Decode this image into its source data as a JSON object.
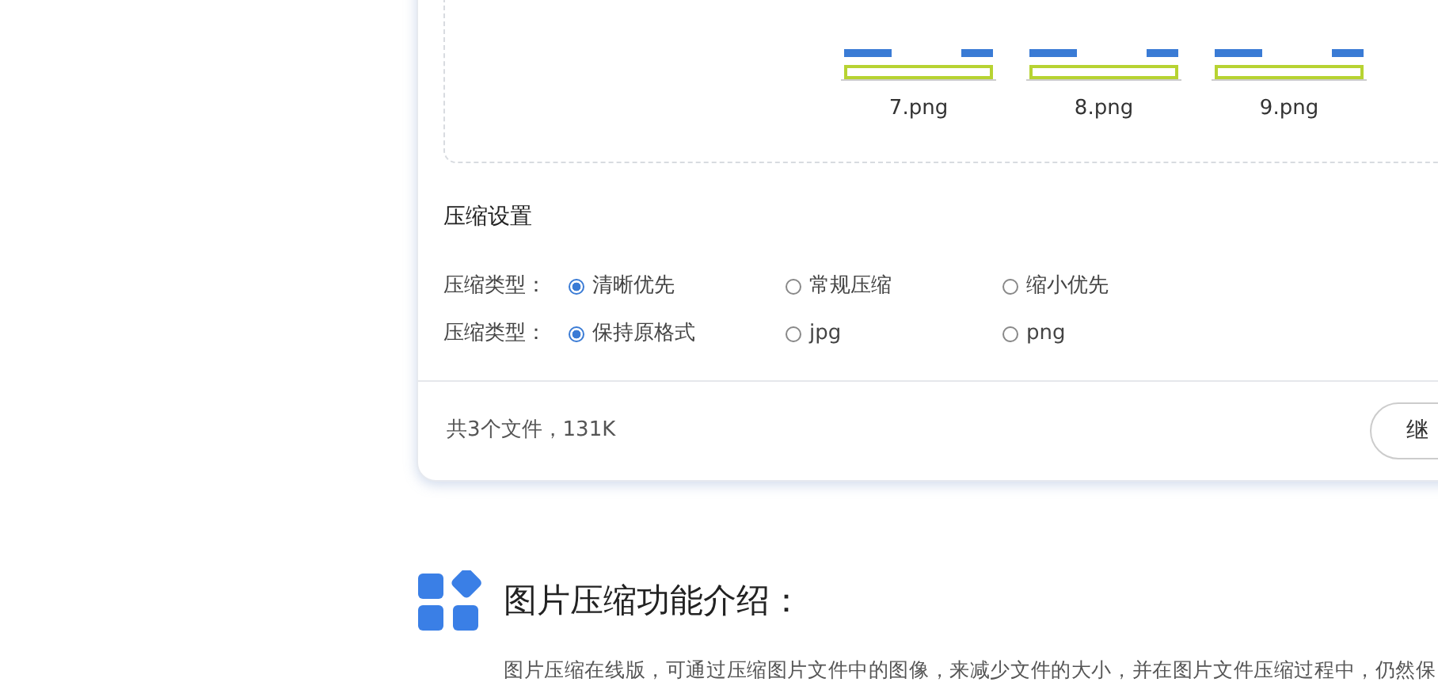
{
  "upload_area": {
    "thumbnails": [
      {
        "filename": "7.png"
      },
      {
        "filename": "8.png"
      },
      {
        "filename": "9.png"
      }
    ]
  },
  "settings": {
    "title": "压缩设置",
    "groups": [
      {
        "label": "压缩类型：",
        "options": [
          {
            "label": "清晰优先",
            "selected": true
          },
          {
            "label": "常规压缩",
            "selected": false
          },
          {
            "label": "缩小优先",
            "selected": false
          }
        ]
      },
      {
        "label": "压缩类型：",
        "options": [
          {
            "label": "保持原格式",
            "selected": true
          },
          {
            "label": "jpg",
            "selected": false
          },
          {
            "label": "png",
            "selected": false
          }
        ]
      }
    ]
  },
  "footer": {
    "summary": "共3个文件，131K",
    "button": "继"
  },
  "intro": {
    "title": "图片压缩功能介绍：",
    "paragraph": "图片压缩在线版，可通过压缩图片文件中的图像，来减少文件的大小，并在图片文件压缩过程中，仍然保"
  }
}
